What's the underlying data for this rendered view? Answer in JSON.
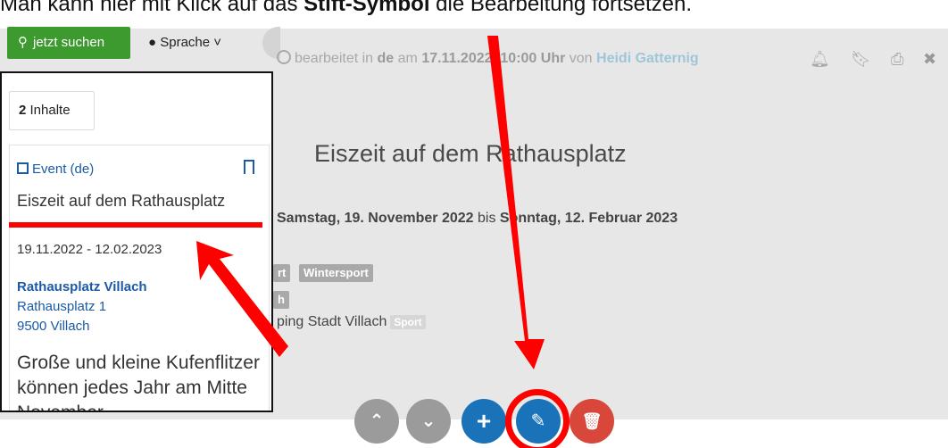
{
  "caption": {
    "before": "Man kann hier mit Klick auf das ",
    "bold": "Stift-Symbol",
    "after": " die Bearbeitung fortsetzen."
  },
  "toolbar": {
    "search_label": "jetzt suchen",
    "language_label": "Sprache ˅"
  },
  "meta": {
    "prefix": "bearbeitet in ",
    "lang": "de",
    "on": " am ",
    "datetime": "17.11.2022, 10:00 Uhr",
    "by": " von ",
    "author": "Heidi Gatternig"
  },
  "detail": {
    "title": "Eiszeit auf dem Rathausplatz",
    "date_from": "Samstag, 19. November 2022",
    "date_to_word": " bis ",
    "date_to": "Sonntag, 12. Februar 2023",
    "tag_sport_partial": "rt",
    "tag_wintersport": "Wintersport",
    "tag_partial_second": "h",
    "organizer": "ping Stadt Villach",
    "organizer_tag": "Sport"
  },
  "list": {
    "count_number": "2",
    "count_label": " Inhalte",
    "card": {
      "type": "Event (de)",
      "title": "Eiszeit auf dem Rathausplatz",
      "dates": "19.11.2022 - 12.02.2023",
      "location_name": "Rathausplatz Villach",
      "street": "Rathausplatz 1",
      "city": "9500 Villach",
      "teaser": "Große und kleine Kufenflitzer können jedes Jahr am Mitte November..."
    }
  },
  "icons": {
    "bell": "bell-icon",
    "bookmark": "bookmark-icon",
    "print": "print-icon",
    "close": "close-icon"
  },
  "colors": {
    "accent_green": "#3d9a2f",
    "link_blue": "#1a5aa6",
    "annotation_red": "#ff0000",
    "delete_red": "#d9463a"
  }
}
